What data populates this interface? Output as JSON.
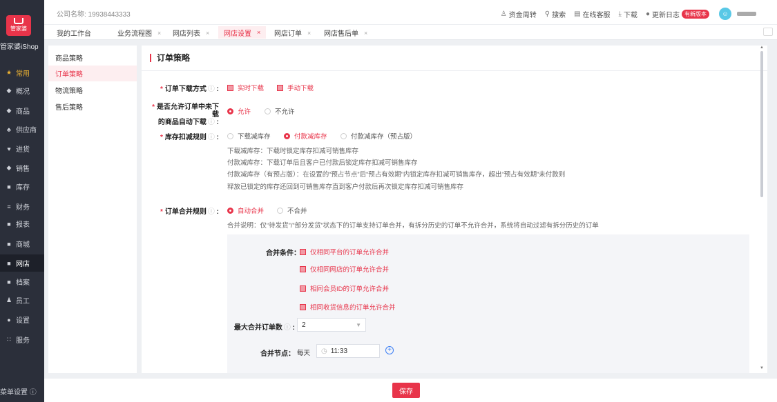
{
  "app": {
    "logo_text": "管家婆",
    "brand": "管家婆iShop",
    "menu_settings": "菜单设置 ⓘ"
  },
  "nav": [
    {
      "label": "常用",
      "icon": "star-icon",
      "glyph": "★"
    },
    {
      "label": "概况",
      "icon": "overview-icon",
      "glyph": "◆"
    },
    {
      "label": "商品",
      "icon": "goods-icon",
      "glyph": "◆"
    },
    {
      "label": "供应商",
      "icon": "supplier-icon",
      "glyph": "♣"
    },
    {
      "label": "进货",
      "icon": "cart-icon",
      "glyph": "♥"
    },
    {
      "label": "销售",
      "icon": "sales-icon",
      "glyph": "◆"
    },
    {
      "label": "库存",
      "icon": "inventory-icon",
      "glyph": "■"
    },
    {
      "label": "财务",
      "icon": "finance-icon",
      "glyph": "≡"
    },
    {
      "label": "报表",
      "icon": "report-icon",
      "glyph": "■"
    },
    {
      "label": "商城",
      "icon": "mall-icon",
      "glyph": "■"
    },
    {
      "label": "网店",
      "icon": "shop-icon",
      "glyph": "■"
    },
    {
      "label": "档案",
      "icon": "archive-icon",
      "glyph": "■"
    },
    {
      "label": "员工",
      "icon": "staff-icon",
      "glyph": "♟"
    },
    {
      "label": "设置",
      "icon": "settings-icon",
      "glyph": "●"
    },
    {
      "label": "服务",
      "icon": "service-icon",
      "glyph": "∷"
    }
  ],
  "topbar": {
    "company": "公司名称: 19938443333",
    "tools": [
      {
        "label": "资金周转",
        "icon": "money-icon",
        "glyph": "♙"
      },
      {
        "label": "搜索",
        "icon": "search-icon",
        "glyph": "⚲"
      },
      {
        "label": "在线客服",
        "icon": "chat-icon",
        "glyph": "▤"
      },
      {
        "label": "下载",
        "icon": "download-icon",
        "glyph": "⤓"
      },
      {
        "label": "更新日志",
        "icon": "update-icon",
        "glyph": "●"
      }
    ],
    "update_badge": "有新版本"
  },
  "tabs": [
    {
      "label": "我的工作台",
      "closable": false
    },
    {
      "label": "业务流程图",
      "closable": true
    },
    {
      "label": "网店列表",
      "closable": true
    },
    {
      "label": "网店设置",
      "closable": true,
      "active": true
    },
    {
      "label": "网店订单",
      "closable": true
    },
    {
      "label": "网店售后单",
      "closable": true
    }
  ],
  "side_menu": [
    "商品策略",
    "订单策略",
    "物流策略",
    "售后策略"
  ],
  "page": {
    "title": "订单策略",
    "download_mode": {
      "label": "订单下载方式",
      "options": [
        "实时下载",
        "手动下载"
      ]
    },
    "auto_download": {
      "label_line1": "是否允许订单中未下载",
      "label_line2": "的商品自动下载",
      "options": [
        "允许",
        "不允许"
      ],
      "selected": 0
    },
    "stock_rule": {
      "label": "库存扣减规则",
      "options": [
        "下载减库存",
        "付款减库存",
        "付款减库存（预占版）"
      ],
      "selected": 1,
      "desc": [
        "下载减库存：下载时锁定库存扣减可销售库存",
        "付款减库存：下载订单后且客户已付款后锁定库存扣减可销售库存",
        "付款减库存（有预占版）：在设置的“预占节点”后“预占有效期”内锁定库存扣减可销售库存，超出“预占有效期”未付款则",
        "释放已锁定的库存还回到可销售库存直到客户付款后再次锁定库存扣减可销售库存"
      ]
    },
    "merge_rule": {
      "label": "订单合并规则",
      "options": [
        "自动合并",
        "不合并"
      ],
      "selected": 0,
      "desc": "合并说明：仅“待发货”/“部分发货”状态下的订单支持订单合并，有拆分历史的订单不允许合并，系统将自动过滤有拆分历史的订单",
      "conditions_label": "合并条件：",
      "conditions": [
        "仅相同平台的订单允许合并",
        "仅相同网店的订单允许合并",
        "相同会员ID的订单允许合并",
        "相同收货信息的订单允许合并"
      ],
      "max_label": "最大合并订单数",
      "max_value": "2",
      "node_label": "合并节点：",
      "node_prefix": "每天",
      "node_time": "11:33"
    },
    "save": "保存"
  },
  "colors": {
    "accent": "#e8344a",
    "nav_bg": "#2b2f3a",
    "star": "#f2b632"
  }
}
